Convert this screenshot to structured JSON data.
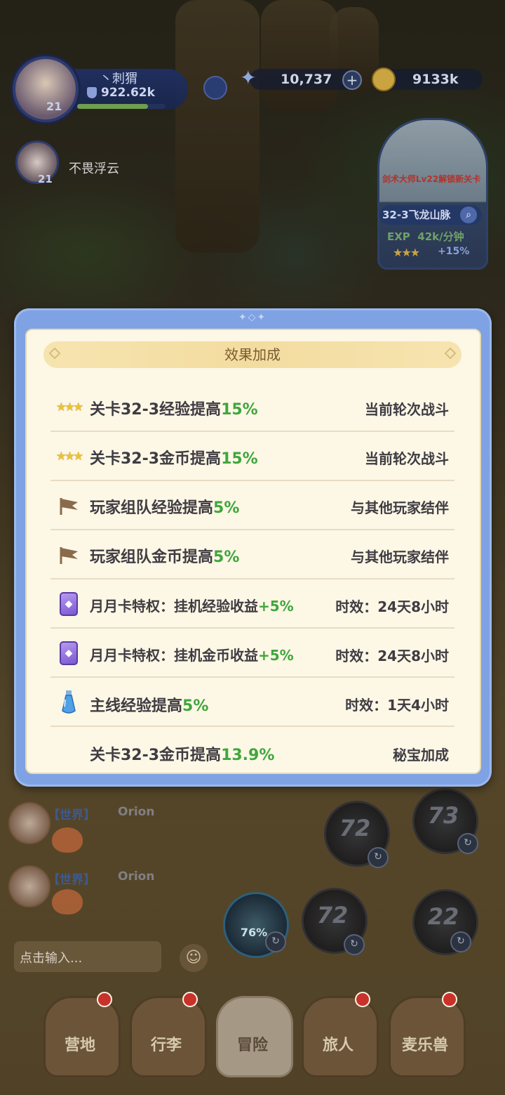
{
  "hud": {
    "player_name": "丶刺猬",
    "player_power": "922.62k",
    "player_level": "21",
    "power_progress": 0.8,
    "gems": "10,737",
    "gold": "9133k",
    "ally_name": "不畏浮云",
    "ally_level": "21"
  },
  "stage_card": {
    "unlock_text": "剑术大师Lv22解锁新关卡",
    "stage_name": "32-3飞龙山脉",
    "exp_label": "EXP",
    "exp_rate": "42k/分钟",
    "stars": "★★★",
    "bonus": "+15%"
  },
  "dialog": {
    "title": "效果加成",
    "rows": [
      {
        "icon": "three-stars-icon",
        "label": "关卡32-3经验提高",
        "value": "15%",
        "right": "当前轮次战斗"
      },
      {
        "icon": "three-stars-icon",
        "label": "关卡32-3金币提高",
        "value": "15%",
        "right": "当前轮次战斗"
      },
      {
        "icon": "team-flag-icon",
        "label": "玩家组队经验提高",
        "value": "5%",
        "right": "与其他玩家结伴"
      },
      {
        "icon": "team-flag-icon",
        "label": "玩家组队金币提高",
        "value": "5%",
        "right": "与其他玩家结伴"
      },
      {
        "icon": "monthly-card-icon",
        "label": "月月卡特权：挂机经验收益",
        "value": "+5%",
        "right": "时效：24天8小时"
      },
      {
        "icon": "monthly-card-icon",
        "label": "月月卡特权：挂机金币收益",
        "value": "+5%",
        "right": "时效：24天8小时"
      },
      {
        "icon": "potion-icon",
        "label": "主线经验提高",
        "value": "5%",
        "right": "时效：1天4小时"
      },
      {
        "icon": "",
        "label": "关卡32-3金币提高",
        "value": "13.9%",
        "right": "秘宝加成"
      }
    ]
  },
  "chat": {
    "messages": [
      {
        "tag": "【世界】",
        "name": "Orion"
      },
      {
        "tag": "【世界】",
        "name": "Orion"
      }
    ],
    "input_placeholder": "点击输入..."
  },
  "skills": {
    "main_percent": "76%",
    "cooldowns": [
      "72",
      "73",
      "72",
      "22"
    ]
  },
  "nav": {
    "items": [
      {
        "label": "营地",
        "badge": true
      },
      {
        "label": "行李",
        "badge": true
      },
      {
        "label": "冒险",
        "badge": false,
        "active": true
      },
      {
        "label": "旅人",
        "badge": true
      },
      {
        "label": "麦乐兽",
        "badge": true
      }
    ]
  },
  "colors": {
    "accent_green": "#3fa63c",
    "dialog_frame": "#7ea2e3",
    "dialog_bg": "#fdf7e6",
    "badge_red": "#c8322a"
  }
}
